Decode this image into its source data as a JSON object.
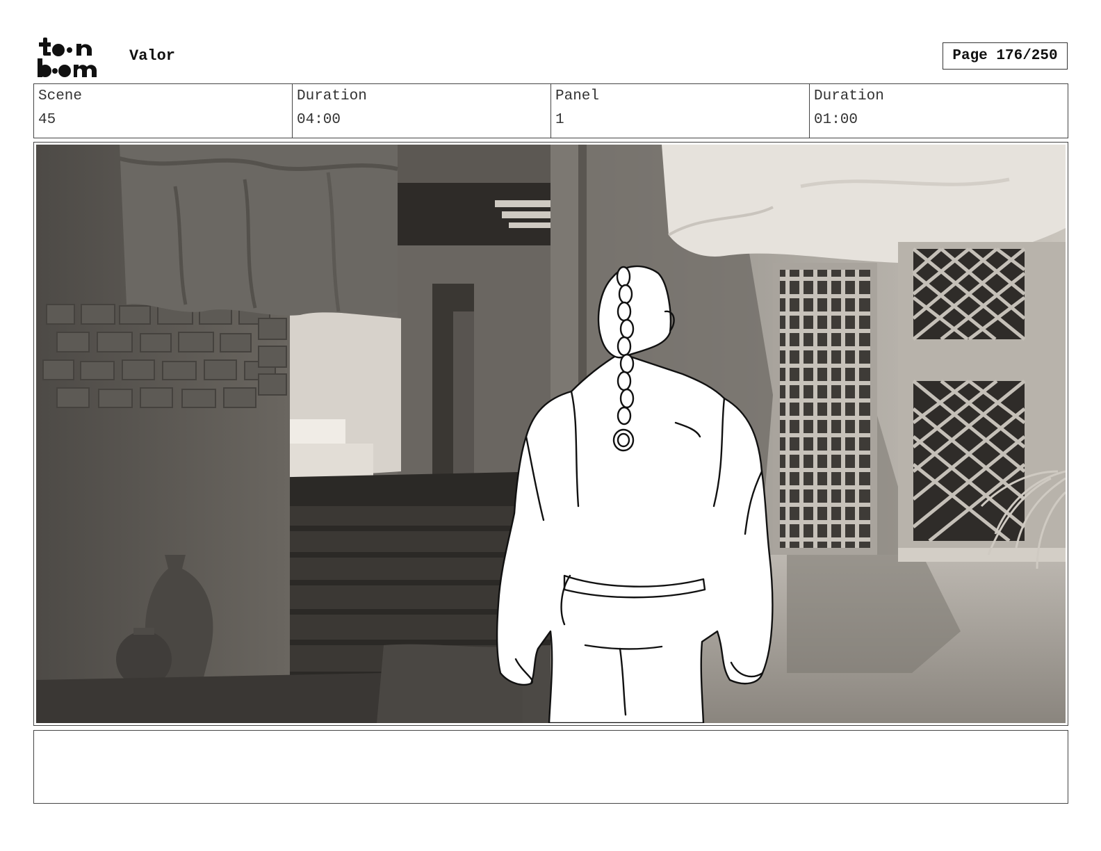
{
  "header": {
    "logo_text": "toon boom",
    "project_title": "Valor",
    "page_label": "Page 176/250"
  },
  "info": {
    "scene_label": "Scene",
    "scene_value": "45",
    "scene_duration_label": "Duration",
    "scene_duration_value": "04:00",
    "panel_label": "Panel",
    "panel_value": "1",
    "panel_duration_label": "Duration",
    "panel_duration_value": "01:00"
  },
  "notes": {
    "text": ""
  }
}
